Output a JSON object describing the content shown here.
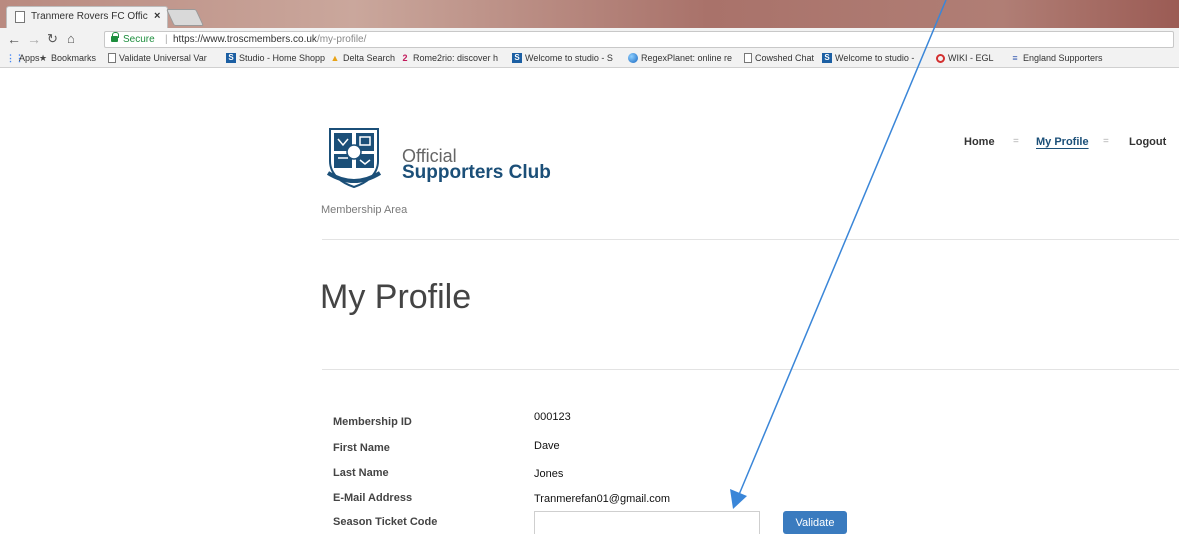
{
  "browser": {
    "tab_title": "Tranmere Rovers FC Offic",
    "tab_close": "×",
    "secure_label": "Secure",
    "url_host": "https://www.troscmembers.co.uk",
    "url_path": "/my-profile/",
    "bookmarks": [
      {
        "label": "Apps",
        "icon": "apps-icon"
      },
      {
        "label": "Bookmarks",
        "icon": "star-icon"
      },
      {
        "label": "Validate Universal Var",
        "icon": "page-icon"
      },
      {
        "label": "Studio - Home Shopp",
        "icon": "studio-icon"
      },
      {
        "label": "Delta Search",
        "icon": "delta-icon"
      },
      {
        "label": "Rome2rio: discover h",
        "icon": "rome2rio-icon"
      },
      {
        "label": "Welcome to studio - S",
        "icon": "studio-icon"
      },
      {
        "label": "RegexPlanet: online re",
        "icon": "globe-icon"
      },
      {
        "label": "Cowshed Chat",
        "icon": "page-icon"
      },
      {
        "label": "Welcome to studio -",
        "icon": "studio-icon"
      },
      {
        "label": "WIKI - EGL",
        "icon": "wiki-icon"
      },
      {
        "label": "England Supporters",
        "icon": "england-icon"
      }
    ]
  },
  "site": {
    "brand_line1": "Official",
    "brand_line2": "Supporters Club",
    "subtitle": "Membership Area",
    "nav": {
      "home": "Home",
      "my_profile": "My Profile",
      "logout": "Logout",
      "separator": "="
    }
  },
  "profile": {
    "heading": "My Profile",
    "fields": [
      {
        "label": "Membership ID",
        "value": "000123"
      },
      {
        "label": "First Name",
        "value": "Dave"
      },
      {
        "label": "Last Name",
        "value": "Jones"
      },
      {
        "label": "E-Mail Address",
        "value": "Tranmerefan01@gmail.com"
      },
      {
        "label": "Season Ticket Code",
        "value": ""
      }
    ],
    "validate_label": "Validate"
  },
  "colors": {
    "brand_blue": "#1b4f78",
    "button_blue": "#3a7bbf",
    "annotation_arrow": "#3a86d8"
  }
}
